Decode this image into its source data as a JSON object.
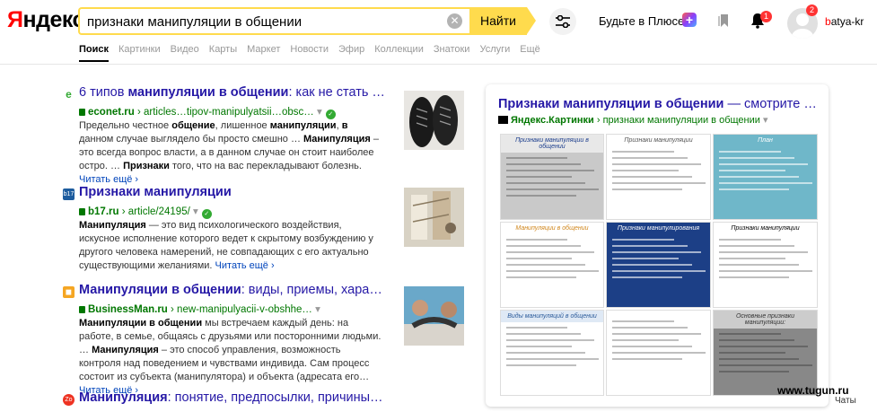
{
  "brand": {
    "logo_first": "Я",
    "logo_rest": "ндекс"
  },
  "search": {
    "query": "признаки манипуляции в общении",
    "button_label": "Найти"
  },
  "header": {
    "plus_label": "Будьте в Плюсе",
    "notifications_count": "1",
    "avatar_count": "2",
    "user_first": "b",
    "user_rest": "atya-kr"
  },
  "tabs": [
    "Поиск",
    "Картинки",
    "Видео",
    "Карты",
    "Маркет",
    "Новости",
    "Эфир",
    "Коллекции",
    "Знатоки",
    "Услуги",
    "Ещё"
  ],
  "results": [
    {
      "title_plain": "6 типов ",
      "title_bold": "манипуляции в общении",
      "title_tail": ": как не стать …",
      "domain": "econet.ru",
      "path": " › articles…tipov-manipulyatsii…obsc…",
      "snippet": [
        {
          "t": "Предельно честное ",
          "b": false
        },
        {
          "t": "общение",
          "b": true
        },
        {
          "t": ", лишенное ",
          "b": false
        },
        {
          "t": "манипуляции",
          "b": true
        },
        {
          "t": ", ",
          "b": false
        },
        {
          "t": "в",
          "b": true
        },
        {
          "t": " данном случае выглядело бы просто смешно … ",
          "b": false
        },
        {
          "t": "Манипуляция",
          "b": true
        },
        {
          "t": " – это всегда вопрос власти, а в данном случае он стоит наиболее остро. … ",
          "b": false
        },
        {
          "t": "Признаки",
          "b": true
        },
        {
          "t": " того, что на вас перекладывают болезнь. ",
          "b": false
        }
      ],
      "read_more": "Читать ещё ›"
    },
    {
      "title_plain": "",
      "title_bold": "Признаки манипуляции",
      "title_tail": "",
      "domain": "b17.ru",
      "path": " › article/24195/",
      "snippet": [
        {
          "t": "Манипуляция",
          "b": true
        },
        {
          "t": " — это вид психологического воздействия, искусное исполнение которого ведет к скрытому возбуждению у другого человека намерений, не совпадающих с его актуально существующими желаниями. ",
          "b": false
        }
      ],
      "read_more": "Читать ещё ›"
    },
    {
      "title_plain": "",
      "title_bold": "Манипуляции в общении",
      "title_tail": ": виды, приемы, хара…",
      "domain": "BusinessMan.ru",
      "path": " › new-manipulyacii-v-obshhe…",
      "snippet": [
        {
          "t": "Манипуляции в общении",
          "b": true
        },
        {
          "t": " мы встречаем каждый день: на работе, в семье, общаясь с друзьями или посторонними людьми. … ",
          "b": false
        },
        {
          "t": "Манипуляция",
          "b": true
        },
        {
          "t": " – это способ управления, возможность контроля над поведением и чувствами индивида. Сам процесс состоит из субъекта (манипулятора) и объекта (адресата его… ",
          "b": false
        }
      ],
      "read_more": "Читать ещё ›"
    },
    {
      "title_plain": "",
      "title_bold": "Манипуляция",
      "title_tail": ": понятие, предпосылки, причины…",
      "domain": "",
      "path": "",
      "snippet": [],
      "read_more": ""
    }
  ],
  "panel": {
    "title_bold": "Признаки манипуляции в общении",
    "title_tail": " — смотрите …",
    "source_bold": "Яндекс.Картинки",
    "source_path": " › признаки манипуляции в общении",
    "thumbs": [
      {
        "kind": "slide-grey",
        "heading": "Признаки манипуляции в общении"
      },
      {
        "kind": "slide-white",
        "heading": "Признаки манипуляции"
      },
      {
        "kind": "slide-teal",
        "heading": "План"
      },
      {
        "kind": "slide-white-list",
        "heading": "Манипуляции в общении"
      },
      {
        "kind": "slide-blue",
        "heading": "Признаки манипулирования"
      },
      {
        "kind": "slide-text",
        "heading": "Признаки манипуляции"
      },
      {
        "kind": "slide-doc",
        "heading": "Виды манипуляций в общении"
      },
      {
        "kind": "slide-doc2",
        "heading": ""
      },
      {
        "kind": "slide-dark",
        "heading": "Основные признаки манипуляции:"
      }
    ]
  },
  "watermark": "www.tugun.ru",
  "chat_label": "Чаты"
}
